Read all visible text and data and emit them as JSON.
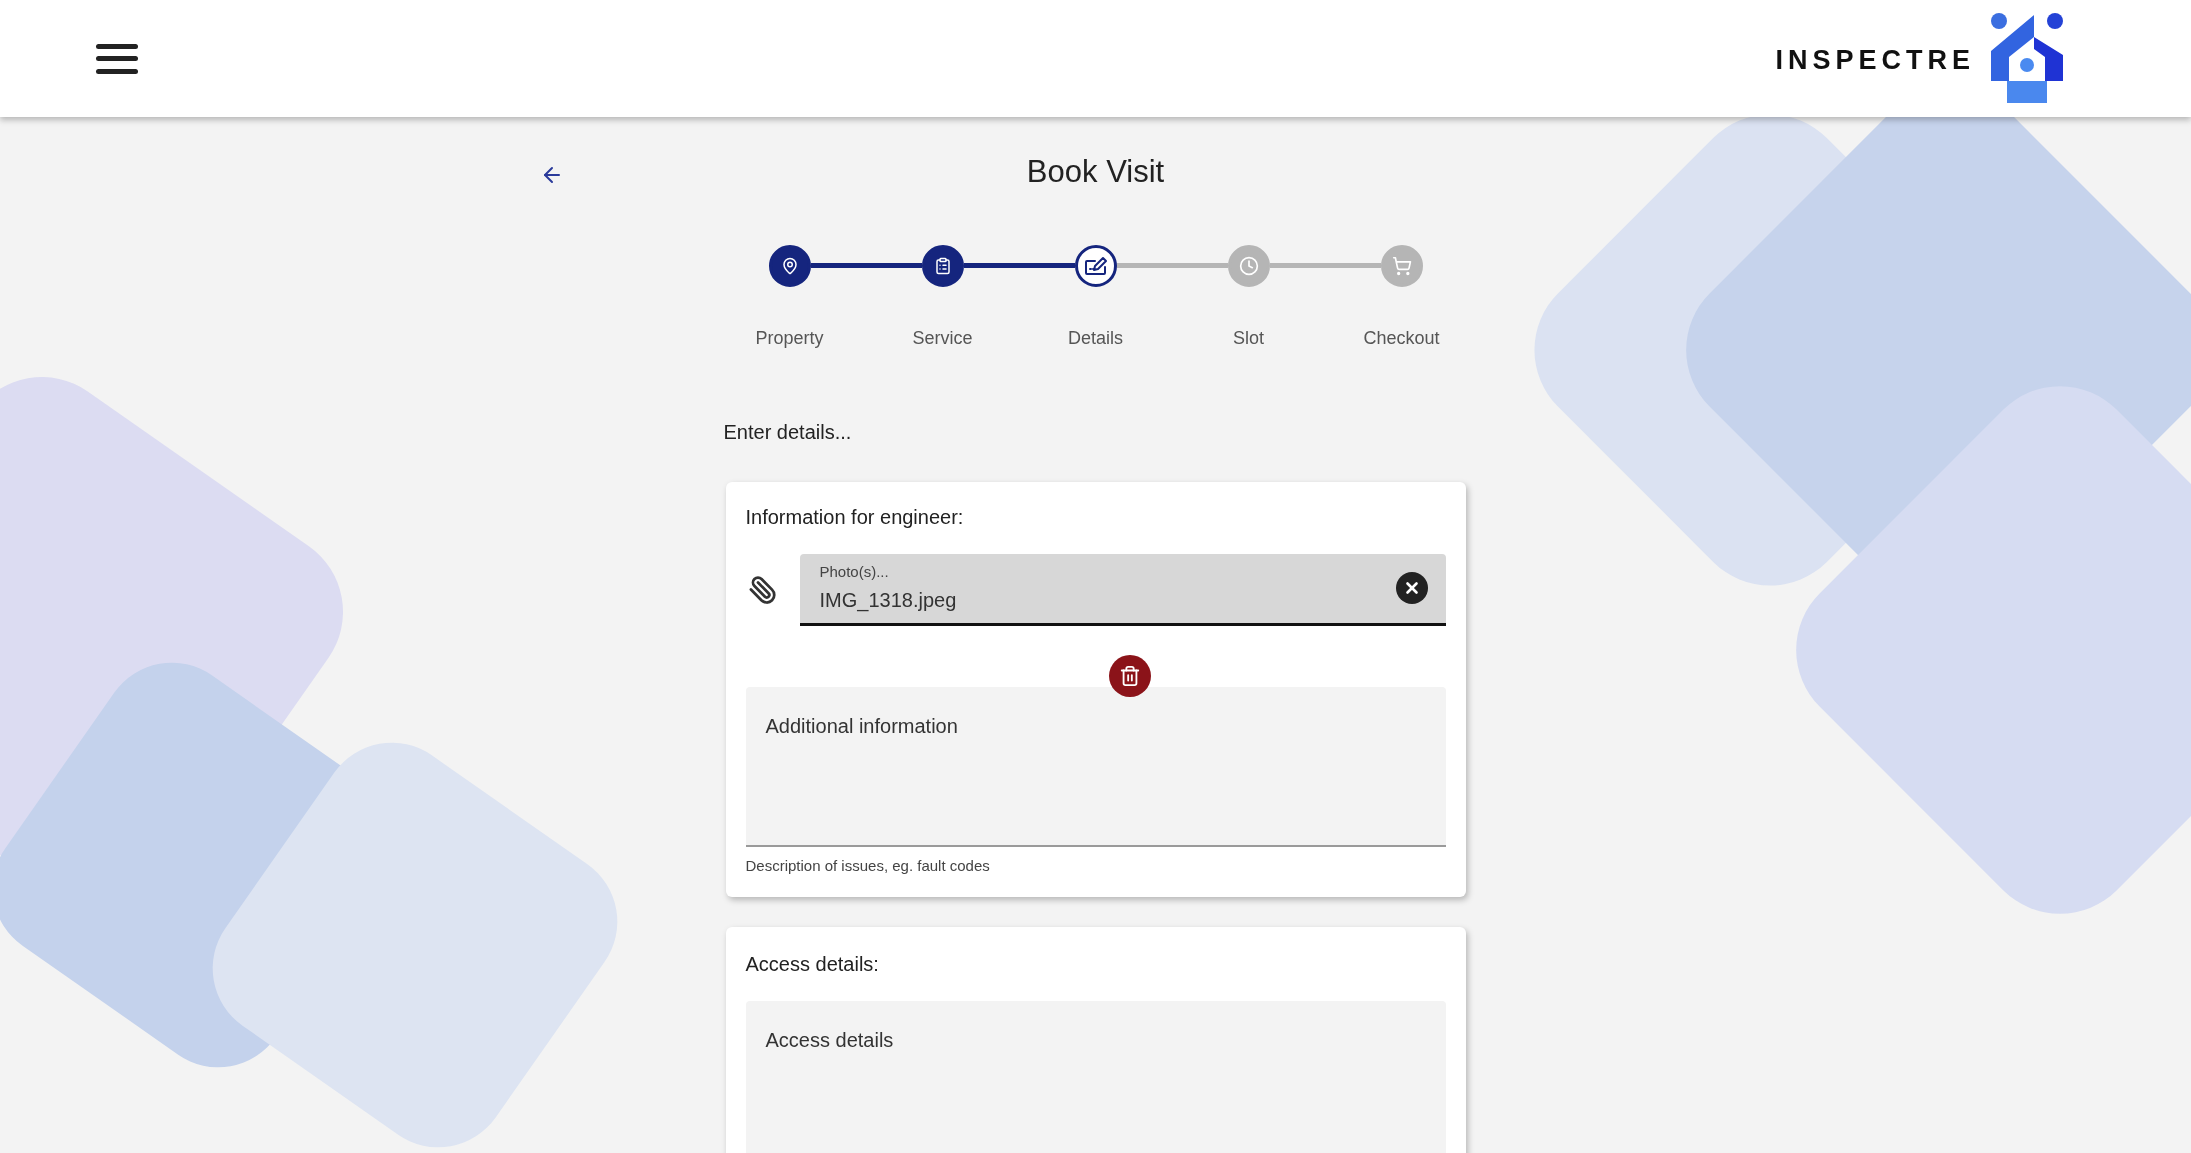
{
  "header": {
    "brand": "INSPECTRE"
  },
  "page": {
    "title": "Book Visit"
  },
  "steps": [
    {
      "label": "Property",
      "done": true,
      "selected": false
    },
    {
      "label": "Service",
      "done": true,
      "selected": false
    },
    {
      "label": "Details",
      "done": false,
      "selected": true
    },
    {
      "label": "Slot",
      "done": false,
      "selected": false
    },
    {
      "label": "Checkout",
      "done": false,
      "selected": false
    }
  ],
  "intro": "Enter details...",
  "engineer_card": {
    "heading": "Information for engineer:",
    "photo_field": {
      "label": "Photo(s)...",
      "value": "IMG_1318.jpeg"
    },
    "additional_info": {
      "placeholder": "Additional information",
      "helper": "Description of issues, eg. fault codes"
    }
  },
  "access_card": {
    "heading": "Access details:",
    "field": {
      "placeholder": "Access details"
    }
  }
}
